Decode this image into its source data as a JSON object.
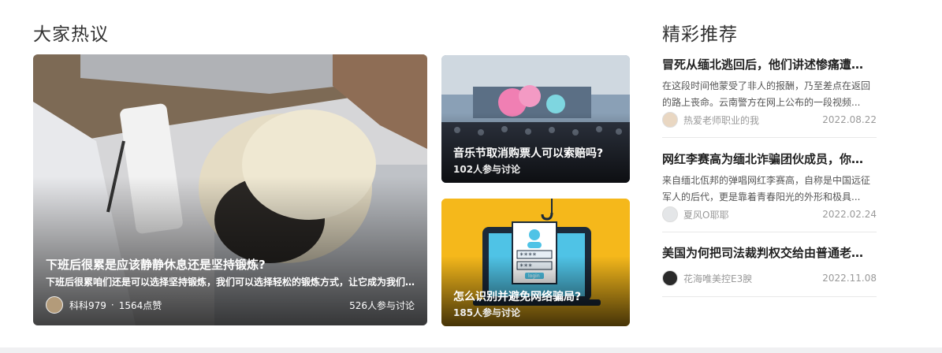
{
  "left_section": {
    "title": "大家热议",
    "featured": {
      "title": "下班后很累是应该静静休息还是坚持锻炼?",
      "description": "下班后很累咱们还是可以选择坚持锻炼，我们可以选择轻松的锻炼方式，让它成为我们…",
      "author": "科科979",
      "separator": "·",
      "likes": "1564点赞",
      "discussion": "526人参与讨论"
    },
    "cards": [
      {
        "title": "音乐节取消购票人可以索赔吗?",
        "discussion": "102人参与讨论"
      },
      {
        "title": "怎么识别并避免网络骗局?",
        "discussion": "185人参与讨论"
      }
    ]
  },
  "right_section": {
    "title": "精彩推荐",
    "items": [
      {
        "title": "冒死从缅北逃回后，他们讲述惨痛遭…",
        "description": "在这段时间他蒙受了非人的报酬，乃至差点在返回的路上丧命。云南警方在网上公布的一段视频...",
        "author": "热爱老师职业的我",
        "date": "2022.08.22"
      },
      {
        "title": "网红李赛高为缅北诈骗团伙成员，你…",
        "description": "来自缅北佤邦的弹唱网红李赛高，自称是中国远征军人的后代，更是靠着青春阳光的外形和极具...",
        "author": "夏风O耶耶",
        "date": "2022.02.24"
      },
      {
        "title": "美国为何把司法裁判权交给由普通老…",
        "author": "花海唯美控E3腴",
        "date": "2022.11.08"
      }
    ]
  },
  "scam_illustration": {
    "password_row_1": "****",
    "password_row_2": "***",
    "button_text": "login"
  },
  "colors": {
    "accent_yellow": "#f5b81b",
    "text_dark": "#222222",
    "text_muted": "#999999"
  }
}
